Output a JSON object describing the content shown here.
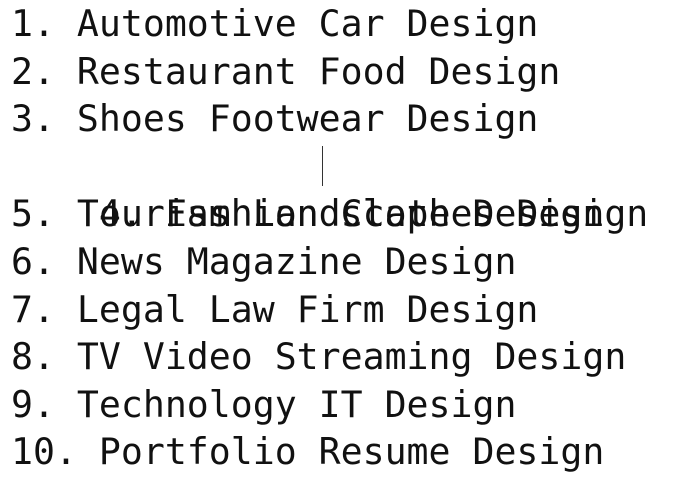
{
  "document": {
    "lines": [
      "1. Automotive Car Design",
      "2. Restaurant Food Design",
      "3. Shoes Footwear Design",
      "4. Fashion Clothes Design",
      "5. Tourism Landscape Design",
      "6. News Magazine Design",
      "7. Legal Law Firm Design",
      "8. TV Video Streaming Design",
      "9. Technology IT Design",
      "10. Portfolio Resume Design"
    ]
  }
}
